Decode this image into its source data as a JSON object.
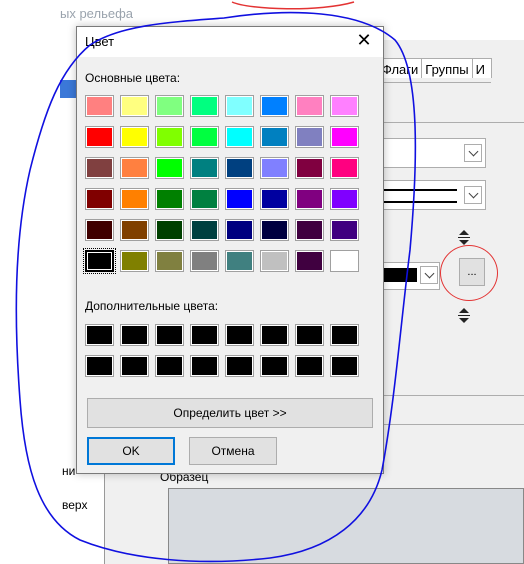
{
  "background": {
    "title_fragment": "ых рельефа",
    "tabs": [
      "Флаги",
      "Группы",
      "И"
    ],
    "text_left_1": "ни",
    "text_left_2": "верх",
    "sample_label": "Образец",
    "dots_button_label": "..."
  },
  "dialog": {
    "title": "Цвет",
    "close_glyph": "✕",
    "basic_colors_label": "Основные цвета:",
    "custom_colors_label": "Дополнительные цвета:",
    "define_button_label": "Определить цвет >>",
    "ok_button_label": "OK",
    "cancel_button_label": "Отмена",
    "basic_colors": [
      [
        "#ff8080",
        "#ffff80",
        "#80ff80",
        "#00ff80",
        "#80ffff",
        "#0080ff",
        "#ff80c0",
        "#ff80ff"
      ],
      [
        "#ff0000",
        "#ffff00",
        "#80ff00",
        "#00ff40",
        "#00ffff",
        "#0080c0",
        "#8080c0",
        "#ff00ff"
      ],
      [
        "#804040",
        "#ff8040",
        "#00ff00",
        "#008080",
        "#004080",
        "#8080ff",
        "#800040",
        "#ff0080"
      ],
      [
        "#800000",
        "#ff8000",
        "#008000",
        "#008040",
        "#0000ff",
        "#0000a0",
        "#800080",
        "#8000ff"
      ],
      [
        "#400000",
        "#804000",
        "#004000",
        "#004040",
        "#000080",
        "#000040",
        "#400040",
        "#400080"
      ],
      [
        "#000000",
        "#808000",
        "#808040",
        "#808080",
        "#408080",
        "#c0c0c0",
        "#400040",
        "#ffffff"
      ]
    ],
    "selected_basic_color": "#000000",
    "custom_colors": [
      [
        "#000000",
        "#000000",
        "#000000",
        "#000000",
        "#000000",
        "#000000",
        "#000000",
        "#000000"
      ],
      [
        "#000000",
        "#000000",
        "#000000",
        "#000000",
        "#000000",
        "#000000",
        "#000000",
        "#000000"
      ]
    ]
  },
  "annotations": {
    "blue_outline_color": "#1010e0",
    "red_circle_color": "#e33333"
  }
}
